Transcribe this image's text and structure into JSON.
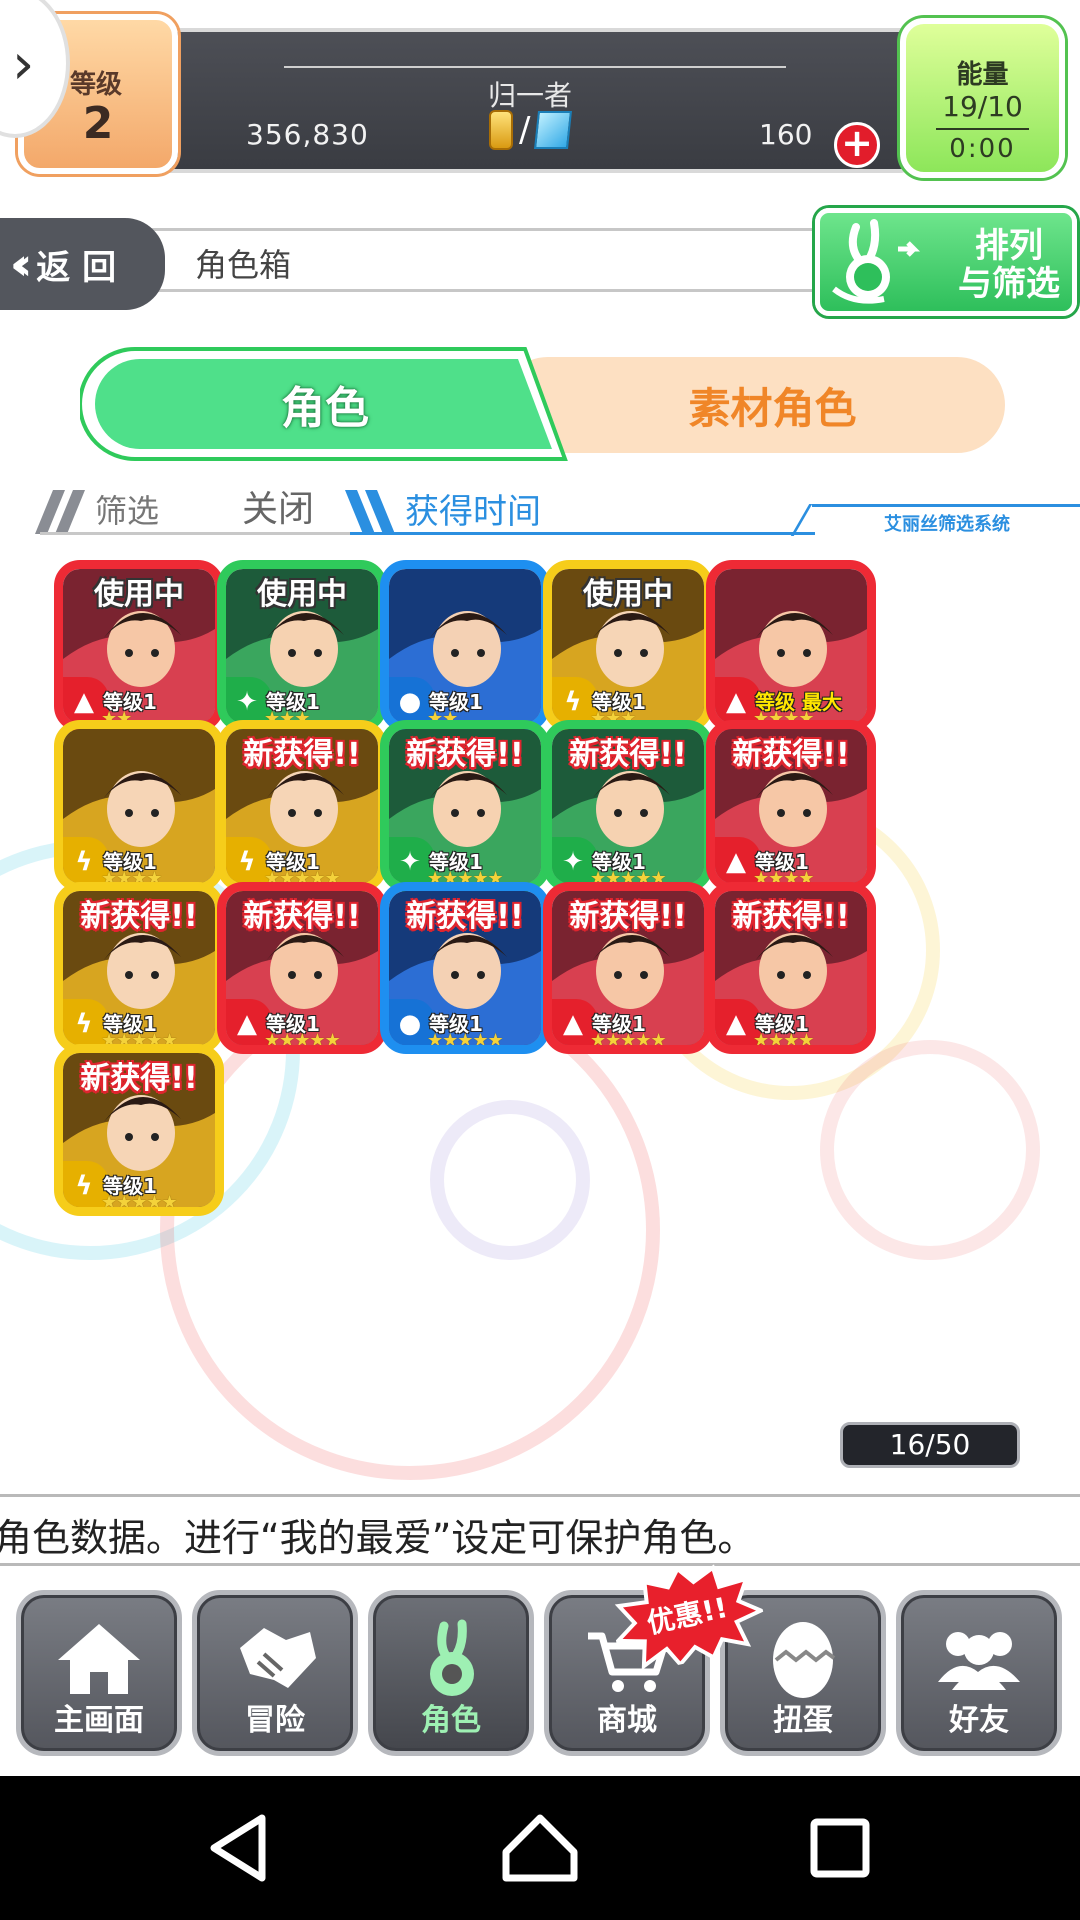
{
  "header": {
    "level_label": "等级",
    "level_value": "2",
    "player_name": "归一者",
    "coins": "356,830",
    "slash": "/",
    "gems": "160",
    "plus_icon": "plus-icon",
    "energy_label": "能量",
    "energy_value": "19/10",
    "energy_timer": "0:00"
  },
  "titlebar": {
    "back_label": "返 回",
    "title": "角色箱",
    "sort_filter_label_1": "排列",
    "sort_filter_label_2": "与筛选"
  },
  "tabs": {
    "characters": "角色",
    "materials": "素材角色"
  },
  "filter": {
    "filter_label": "筛选",
    "filter_state": "关闭",
    "sort_label": "获得时间",
    "system_label": "艾丽丝筛选系统"
  },
  "characters": [
    {
      "badge": "使用中",
      "badge_type": "inuse",
      "element": "fire",
      "level": "等级1",
      "stars": "★★",
      "frame": "red"
    },
    {
      "badge": "使用中",
      "badge_type": "inuse",
      "element": "wind",
      "level": "等级1",
      "stars": "★★★",
      "frame": "green"
    },
    {
      "badge": "",
      "badge_type": "",
      "element": "water",
      "level": "等级1",
      "stars": "★★",
      "frame": "blue"
    },
    {
      "badge": "使用中",
      "badge_type": "inuse",
      "element": "thunder",
      "level": "等级1",
      "stars": "★★★",
      "frame": "yellow"
    },
    {
      "badge": "",
      "badge_type": "",
      "element": "fire",
      "level": "等级 最大",
      "stars": "★★★★",
      "frame": "red"
    },
    {
      "badge": "",
      "badge_type": "",
      "element": "thunder",
      "level": "等级1",
      "stars": "★★★★",
      "frame": "yellow"
    },
    {
      "badge": "新获得!!",
      "badge_type": "new",
      "element": "thunder",
      "level": "等级1",
      "stars": "★★★★★",
      "frame": "yellow"
    },
    {
      "badge": "新获得!!",
      "badge_type": "new",
      "element": "wind",
      "level": "等级1",
      "stars": "★★★★★",
      "frame": "green"
    },
    {
      "badge": "新获得!!",
      "badge_type": "new",
      "element": "wind",
      "level": "等级1",
      "stars": "★★★★★",
      "frame": "green"
    },
    {
      "badge": "新获得!!",
      "badge_type": "new",
      "element": "fire",
      "level": "等级1",
      "stars": "★★★★",
      "frame": "red"
    },
    {
      "badge": "新获得!!",
      "badge_type": "new",
      "element": "thunder",
      "level": "等级1",
      "stars": "★★★★★",
      "frame": "yellow"
    },
    {
      "badge": "新获得!!",
      "badge_type": "new",
      "element": "fire",
      "level": "等级1",
      "stars": "★★★★★",
      "frame": "red"
    },
    {
      "badge": "新获得!!",
      "badge_type": "new",
      "element": "water",
      "level": "等级1",
      "stars": "★★★★★",
      "frame": "blue"
    },
    {
      "badge": "新获得!!",
      "badge_type": "new",
      "element": "fire",
      "level": "等级1",
      "stars": "★★★★★",
      "frame": "red"
    },
    {
      "badge": "新获得!!",
      "badge_type": "new",
      "element": "fire",
      "level": "等级1",
      "stars": "★★★★",
      "frame": "red"
    },
    {
      "badge": "新获得!!",
      "badge_type": "new",
      "element": "thunder",
      "level": "等级1",
      "stars": "★★★★★",
      "frame": "yellow"
    }
  ],
  "counter": "16/50",
  "ticker": "角色数据。进行“我的最爱”设定可保护角色。",
  "nav": {
    "home": "主画面",
    "adventure": "冒险",
    "characters": "角色",
    "shop": "商城",
    "gacha": "扭蛋",
    "friends": "好友",
    "promo": "优惠!!"
  },
  "colors": {
    "frame_red": "#ee2a35",
    "frame_green": "#2fca5b",
    "frame_blue": "#1e8ff0",
    "frame_yellow": "#f6cd1a",
    "tab_active": "#4fe08a",
    "tab_inactive": "#fde0c2",
    "accent_blue": "#2b8fe0"
  }
}
